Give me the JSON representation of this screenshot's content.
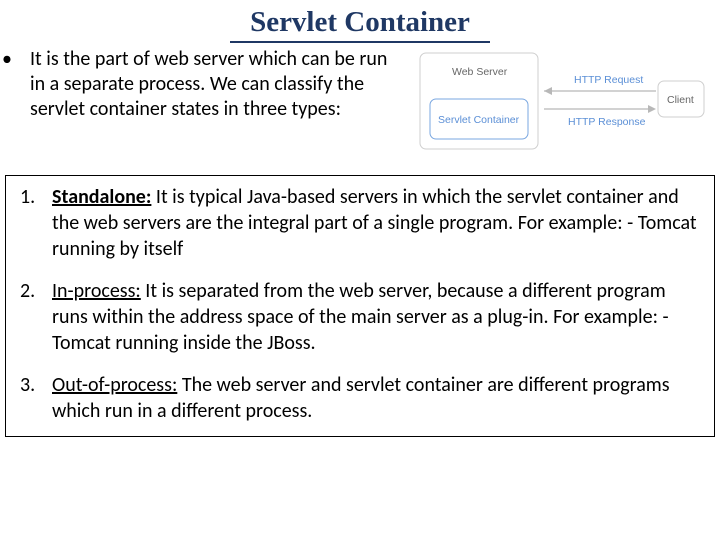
{
  "title": "Servlet Container",
  "intro": {
    "bullet": "•",
    "text": "It is the part of web server which can be run in a separate process. We can classify the servlet container states in three types:"
  },
  "diagram": {
    "outer": "",
    "web_server": "Web Server",
    "servlet_container": "Servlet Container",
    "client": "Client",
    "http_request": "HTTP Request",
    "http_response": "HTTP Response"
  },
  "items": [
    {
      "num": "1.",
      "head": "Standalone:",
      "body_a": " It is typical Java-based servers in which the servlet container and the web servers are the integral part of a single program. For example: - Tomcat running by itself"
    },
    {
      "num": "2.",
      "head": "In-process:",
      "body_a": " It is separated from the web server, because a different program runs within the address space of the main server as a plug-in. For example: - Tomcat running inside the JBoss."
    },
    {
      "num": "3.",
      "head": "Out-of-process:",
      "body_a": " The web server and servlet container are different programs which run in a different process."
    }
  ]
}
